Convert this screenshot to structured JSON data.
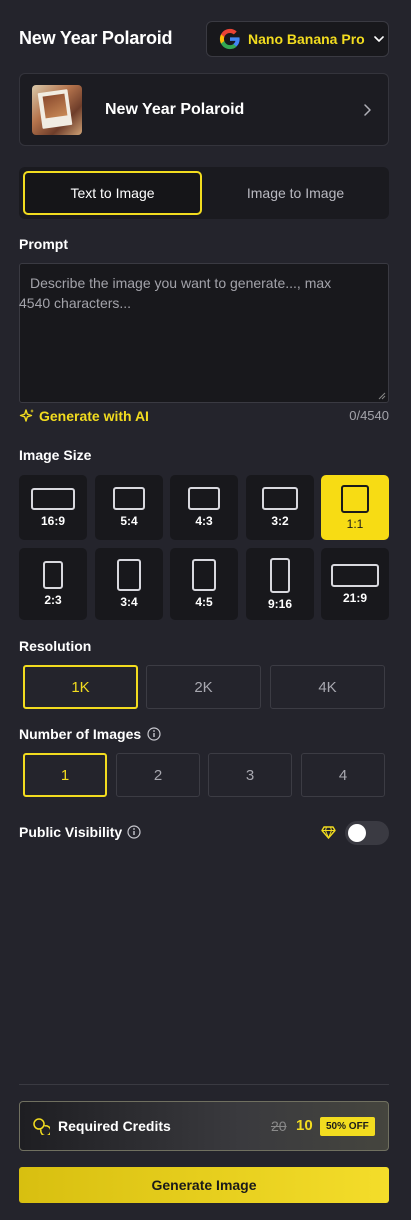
{
  "header": {
    "title": "New Year Polaroid",
    "model": {
      "name": "Nano Banana Pro",
      "icon": "google-icon"
    }
  },
  "template": {
    "name": "New Year Polaroid"
  },
  "tabs": [
    {
      "label": "Text to Image",
      "active": true
    },
    {
      "label": "Image to Image",
      "active": false
    }
  ],
  "prompt": {
    "label": "Prompt",
    "placeholder": "Describe the image you want to generate..., max 4540 characters...",
    "value": "",
    "generate_ai_label": "Generate with AI",
    "counter": "0/4540"
  },
  "image_size": {
    "label": "Image Size",
    "selected": "1:1",
    "options": [
      "16:9",
      "5:4",
      "4:3",
      "3:2",
      "1:1",
      "2:3",
      "3:4",
      "4:5",
      "9:16",
      "21:9"
    ]
  },
  "resolution": {
    "label": "Resolution",
    "selected": "1K",
    "options": [
      "1K",
      "2K",
      "4K"
    ]
  },
  "number_of_images": {
    "label": "Number of Images",
    "selected": "1",
    "options": [
      "1",
      "2",
      "3",
      "4"
    ]
  },
  "public_visibility": {
    "label": "Public Visibility",
    "enabled": false
  },
  "credits": {
    "label": "Required Credits",
    "original": "20",
    "discounted": "10",
    "discount_badge": "50% OFF"
  },
  "generate_button": "Generate Image",
  "colors": {
    "accent": "#f2dc1f",
    "background": "#24242c",
    "panel": "#18181c"
  }
}
